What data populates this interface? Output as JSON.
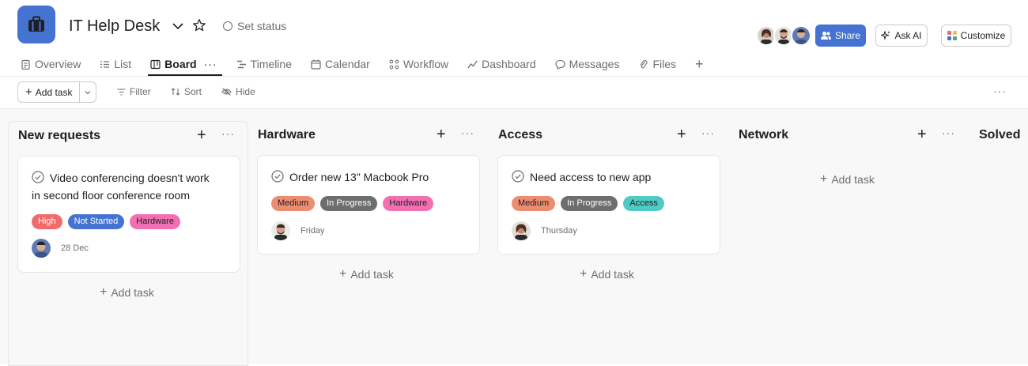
{
  "project": {
    "title": "IT Help Desk",
    "set_status": "Set status"
  },
  "header_buttons": {
    "share": "Share",
    "ask_ai": "Ask AI",
    "customize": "Customize"
  },
  "tabs": [
    {
      "label": "Overview",
      "icon": "overview-icon"
    },
    {
      "label": "List",
      "icon": "list-icon"
    },
    {
      "label": "Board",
      "icon": "board-icon",
      "active": true
    },
    {
      "label": "Timeline",
      "icon": "timeline-icon"
    },
    {
      "label": "Calendar",
      "icon": "calendar-icon"
    },
    {
      "label": "Workflow",
      "icon": "workflow-icon"
    },
    {
      "label": "Dashboard",
      "icon": "dashboard-icon"
    },
    {
      "label": "Messages",
      "icon": "messages-icon"
    },
    {
      "label": "Files",
      "icon": "files-icon"
    }
  ],
  "toolbar": {
    "add_task": "Add task",
    "filter": "Filter",
    "sort": "Sort",
    "hide": "Hide"
  },
  "columns": [
    {
      "title": "New requests",
      "cards": [
        {
          "title_line1": "Video conferencing doesn't work",
          "title_line2": "in second floor conference room",
          "tags": [
            {
              "label": "High",
              "color": "#f06a6a"
            },
            {
              "label": "Not Started",
              "color": "#4573d2"
            },
            {
              "label": "Hardware",
              "color": "#f26fb2"
            }
          ],
          "due": "28 Dec"
        }
      ],
      "add_task": "Add task"
    },
    {
      "title": "Hardware",
      "cards": [
        {
          "title_line1": "Order new 13\" Macbook Pro",
          "title_line2": "",
          "tags": [
            {
              "label": "Medium",
              "color": "#ec8d71"
            },
            {
              "label": "In Progress",
              "color": "#6d6e6f"
            },
            {
              "label": "Hardware",
              "color": "#f26fb2"
            }
          ],
          "due": "Friday"
        }
      ],
      "add_task": "Add task"
    },
    {
      "title": "Access",
      "cards": [
        {
          "title_line1": "Need access to new app",
          "title_line2": "",
          "tags": [
            {
              "label": "Medium",
              "color": "#ec8d71"
            },
            {
              "label": "In Progress",
              "color": "#6d6e6f"
            },
            {
              "label": "Access",
              "color": "#4ecbc4"
            }
          ],
          "due": "Thursday"
        }
      ],
      "add_task": "Add task"
    },
    {
      "title": "Network",
      "cards": [],
      "add_task": "Add task"
    },
    {
      "title": "Solved",
      "cards": [],
      "add_task": ""
    }
  ],
  "colors": {
    "accent": "#4573d2",
    "text": "#1e1f21",
    "muted": "#6d6e6f",
    "border": "#e8e6e6",
    "board_bg": "#f9f8f8"
  }
}
